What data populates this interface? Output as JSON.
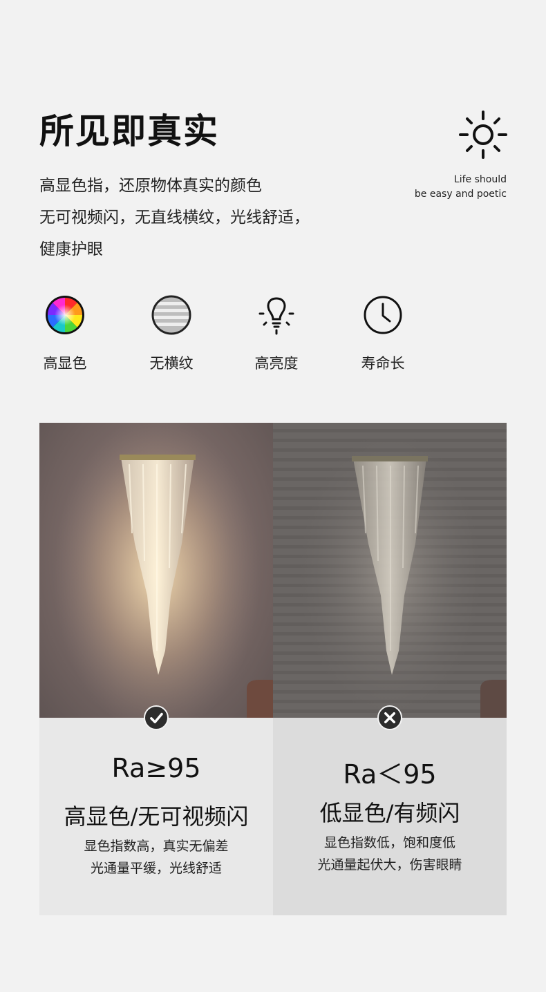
{
  "header": {
    "title": "所见即真实",
    "slogan_line1": "Life should",
    "slogan_line2": "be easy and poetic",
    "sun_icon": "sun-icon"
  },
  "description": {
    "line1": "高显色指，还原物体真实的颜色",
    "line2": "无可视频闪，无直线横纹，光线舒适，",
    "line3": "健康护眼"
  },
  "features": [
    {
      "icon": "color-wheel-icon",
      "label": "高显色"
    },
    {
      "icon": "horizontal-lines-icon",
      "label": "无横纹"
    },
    {
      "icon": "light-bulb-icon",
      "label": "高亮度"
    },
    {
      "icon": "clock-icon",
      "label": "寿命长"
    }
  ],
  "comparison": {
    "good": {
      "badge_icon": "check-icon",
      "ra": "Ra≥95",
      "heading": "高显色/无可视频闪",
      "line1": "显色指数高，真实无偏差",
      "line2": "光通量平缓，光线舒适"
    },
    "bad": {
      "badge_icon": "cross-icon",
      "ra": "Ra＜95",
      "heading": "低显色/有频闪",
      "line1": "显色指数低，饱和度低",
      "line2": "光通量起伏大，伤害眼睛"
    }
  },
  "colors": {
    "background": "#f2f2f2",
    "text": "#1a1a1a",
    "badge": "#2d2d2d"
  }
}
